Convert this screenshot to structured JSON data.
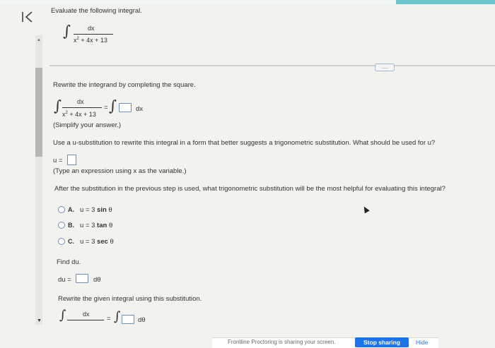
{
  "header": {
    "back_icon": "back-to-start-icon",
    "prompt": "Evaluate the following integral."
  },
  "integral": {
    "numerator": "dx",
    "denominator_base": "x",
    "denominator_exp": "2",
    "denominator_rest": "+ 4x + 13"
  },
  "more_button": {
    "label": "....."
  },
  "step1": {
    "instruction": "Rewrite the integrand by completing the square.",
    "numerator": "dx",
    "denominator_base": "x",
    "denominator_exp": "2",
    "denominator_rest": "+ 4x + 13",
    "equals": "=",
    "differential": "dx",
    "hint": "(Simplify your answer.)"
  },
  "step2": {
    "instruction": "Use a u-substitution to rewrite this integral in a form that better suggests a trigonometric substitution. What should be used for u?",
    "u_label": "u =",
    "hint": "(Type an expression using x as the variable.)"
  },
  "step3": {
    "instruction": "After the substitution in the previous step is used, what trigonometric substitution will be the most helpful for evaluating this integral?",
    "options": [
      {
        "letter": "A.",
        "lhs": "u = 3",
        "func": "sin",
        "var": "θ"
      },
      {
        "letter": "B.",
        "lhs": "u = 3",
        "func": "tan",
        "var": "θ"
      },
      {
        "letter": "C.",
        "lhs": "u = 3",
        "func": "sec",
        "var": "θ"
      }
    ]
  },
  "step4": {
    "instruction": "Find du.",
    "du_label": "du =",
    "dtheta": "dθ"
  },
  "step5": {
    "instruction": "Rewrite the given integral using this substitution.",
    "numerator": "dx",
    "equals": "=",
    "dtheta": "dθ"
  },
  "sharing_bar": {
    "text": "Frontline Proctoring is sharing your screen.",
    "stop_label": "Stop sharing",
    "hide_label": "Hide"
  }
}
